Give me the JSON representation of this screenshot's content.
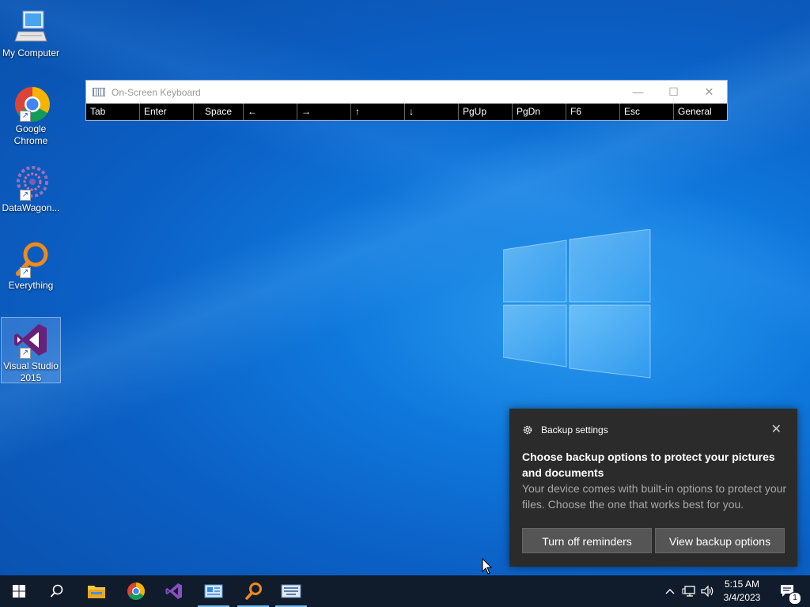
{
  "desktop": {
    "icons": [
      {
        "label": "My Computer",
        "icon": "computer-icon"
      },
      {
        "label": "Google Chrome",
        "icon": "chrome-icon"
      },
      {
        "label": "DataWagon...",
        "icon": "datawagon-icon"
      },
      {
        "label": "Everything",
        "icon": "everything-icon"
      },
      {
        "label": "Visual Studio 2015",
        "icon": "visual-studio-icon"
      }
    ]
  },
  "osk": {
    "title": "On-Screen Keyboard",
    "keys": [
      "Tab",
      "Enter",
      "Space",
      "←",
      "→",
      "↑",
      "↓",
      "PgUp",
      "PgDn",
      "F6",
      "Esc",
      "General"
    ]
  },
  "toast": {
    "app": "Backup settings",
    "title": "Choose backup options to protect your pictures and documents",
    "body": "Your device comes with built-in options to protect your files. Choose the one that works best for you.",
    "button1": "Turn off reminders",
    "button2": "View backup options"
  },
  "taskbar": {
    "time": "5:15 AM",
    "date": "3/4/2023",
    "notification_count": "1",
    "accent": "#76b9ed"
  }
}
